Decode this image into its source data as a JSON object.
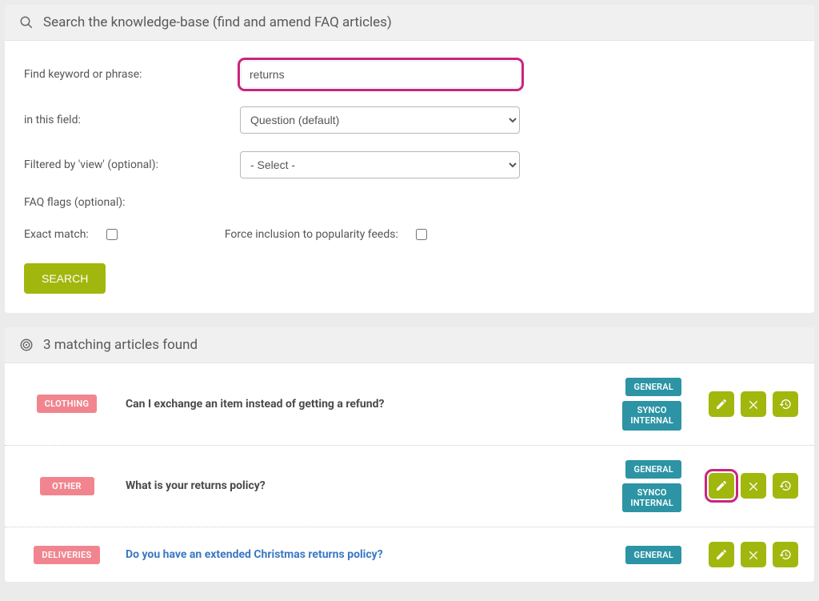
{
  "search_panel": {
    "title": "Search the knowledge-base (find and amend FAQ articles)",
    "labels": {
      "keyword": "Find keyword or phrase:",
      "field": "in this field:",
      "view": "Filtered by 'view' (optional):",
      "flags": "FAQ flags (optional):",
      "exact": "Exact match:",
      "force": "Force inclusion to popularity feeds:"
    },
    "keyword_value": "returns",
    "field_value": "Question (default)",
    "view_value": "- Select -",
    "search_button": "SEARCH"
  },
  "results_panel": {
    "title": "3 matching articles found",
    "rows": [
      {
        "category": "CLOTHING",
        "question": "Can I exchange an item instead of getting a refund?",
        "link": false,
        "badges": [
          "GENERAL",
          "SYNCO INTERNAL"
        ],
        "edit_highlight": false
      },
      {
        "category": "OTHER",
        "question": "What is your returns policy?",
        "link": false,
        "badges": [
          "GENERAL",
          "SYNCO INTERNAL"
        ],
        "edit_highlight": true
      },
      {
        "category": "DELIVERIES",
        "question": "Do you have an extended Christmas returns policy?",
        "link": true,
        "badges": [
          "GENERAL"
        ],
        "edit_highlight": false
      }
    ]
  }
}
